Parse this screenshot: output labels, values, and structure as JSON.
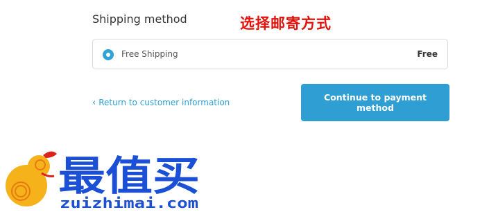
{
  "shipping": {
    "title": "Shipping method",
    "annotation": "选择邮寄方式",
    "option": {
      "label": "Free Shipping",
      "price": "Free",
      "selected": true
    }
  },
  "nav": {
    "return_label": "Return to customer information",
    "continue_label": "Continue to payment method"
  },
  "watermark": {
    "brand": "最值买",
    "url": "zuizhimai.com"
  },
  "colors": {
    "accent": "#2f9fd3",
    "annotation": "#e0120b",
    "watermark": "#1a4fd6",
    "watermark_gourd": "#f5b21a"
  }
}
